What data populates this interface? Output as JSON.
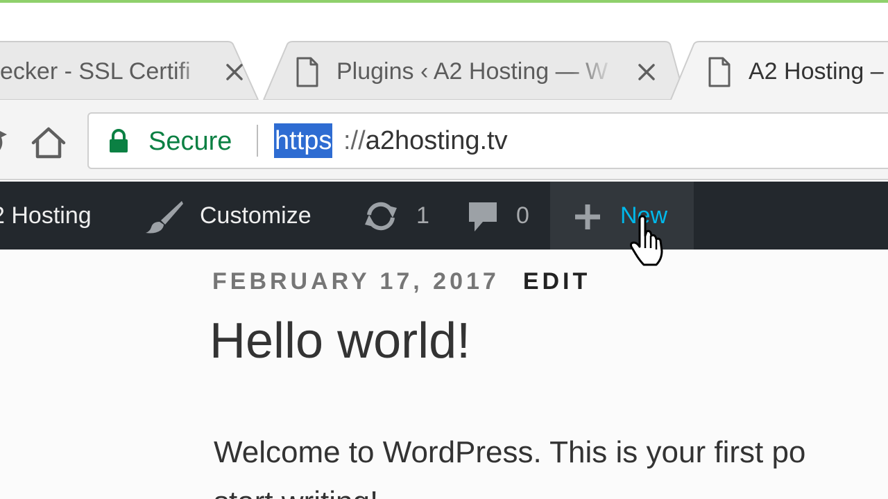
{
  "tabs": [
    {
      "title": "Checker - SSL Certificate",
      "visible_title": "ecker - SSL Certifi",
      "active": false,
      "has_close": true
    },
    {
      "title": "Plugins ‹ A2 Hosting — W",
      "visible_title": "Plugins ‹ A2 Hosting — W",
      "active": false,
      "has_close": true
    },
    {
      "title": "A2 Hosting –",
      "visible_title": "A2 Hosting –",
      "active": true
    }
  ],
  "toolbar": {
    "security_label": "Secure",
    "url_scheme": "https",
    "url_separator": "://",
    "url_host": "a2hosting.tv",
    "icons": {
      "reload": "reload-icon",
      "home": "home-icon",
      "lock": "lock-icon"
    }
  },
  "admin_bar": {
    "site_name": "2 Hosting",
    "customize_label": "Customize",
    "updates_count": "1",
    "comments_count": "0",
    "new_label": "New",
    "icons": {
      "customize": "paintbrush-icon",
      "updates": "updates-icon",
      "comments": "comment-icon",
      "new": "plus-icon"
    }
  },
  "post": {
    "date": "FEBRUARY 17, 2017",
    "edit_label": "EDIT",
    "title": "Hello world!",
    "body_line_1": "Welcome to WordPress. This is your first po",
    "body_line_2": "start writing!"
  },
  "colors": {
    "secure_green": "#0b8043",
    "selection_blue": "#2e6cd2",
    "admin_bar_bg": "#23282d",
    "admin_bar_hover_bg": "#32373c",
    "admin_bar_highlight": "#00b9eb"
  }
}
